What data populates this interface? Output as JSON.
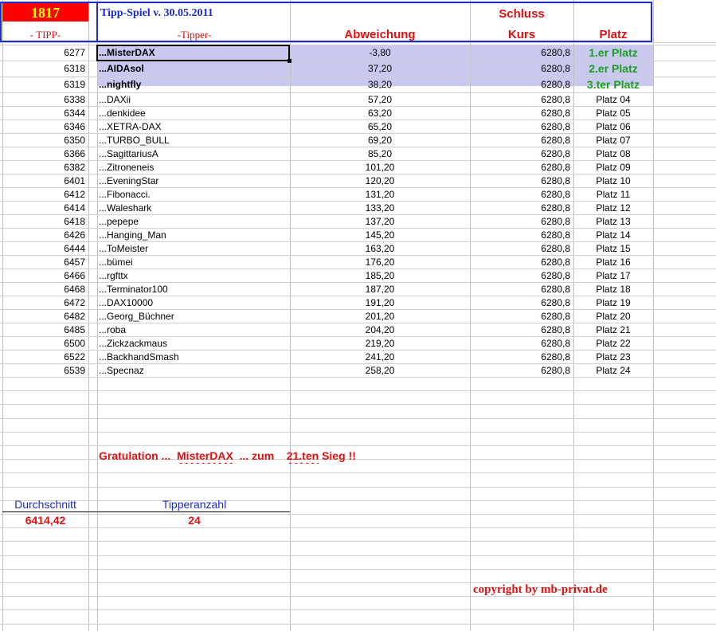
{
  "header": {
    "count": "1817",
    "title": "Tipp-Spiel v. 30.05.2011",
    "schluss": "Schluss",
    "col_tipp": "- TIPP-",
    "col_tipper": "-Tipper-",
    "col_abweichung": "Abweichung",
    "col_kurs": "Kurs",
    "col_platz": "Platz"
  },
  "colors": {
    "count_bg": "#ff0000",
    "count_fg": "#ffff00",
    "header_blue": "#1a2dcc",
    "header_red": "#e01010",
    "podium_bg": "#c8c8f0",
    "podium_green": "#1aa01a"
  },
  "rows": [
    {
      "tipp": "6277",
      "tipper": "...MisterDAX",
      "abw": "-3,80",
      "kurs": "6280,8",
      "platz": "1.er Platz"
    },
    {
      "tipp": "6318",
      "tipper": "...AIDAsol",
      "abw": "37,20",
      "kurs": "6280,8",
      "platz": "2.er Platz"
    },
    {
      "tipp": "6319",
      "tipper": "...nightfly",
      "abw": "38,20",
      "kurs": "6280,8",
      "platz": "3.ter Platz"
    },
    {
      "tipp": "6338",
      "tipper": "...DAXii",
      "abw": "57,20",
      "kurs": "6280,8",
      "platz": "Platz 04"
    },
    {
      "tipp": "6344",
      "tipper": "...denkidee",
      "abw": "63,20",
      "kurs": "6280,8",
      "platz": "Platz 05"
    },
    {
      "tipp": "6346",
      "tipper": "...XETRA-DAX",
      "abw": "65,20",
      "kurs": "6280,8",
      "platz": "Platz 06"
    },
    {
      "tipp": "6350",
      "tipper": "...TURBO_BULL",
      "abw": "69,20",
      "kurs": "6280,8",
      "platz": "Platz 07"
    },
    {
      "tipp": "6366",
      "tipper": "...SagittariusA",
      "abw": "85,20",
      "kurs": "6280,8",
      "platz": "Platz 08"
    },
    {
      "tipp": "6382",
      "tipper": "...Zitroneneis",
      "abw": "101,20",
      "kurs": "6280,8",
      "platz": "Platz 09"
    },
    {
      "tipp": "6401",
      "tipper": "...EveningStar",
      "abw": "120,20",
      "kurs": "6280,8",
      "platz": "Platz 10"
    },
    {
      "tipp": "6412",
      "tipper": "...Fibonacci.",
      "abw": "131,20",
      "kurs": "6280,8",
      "platz": "Platz 11"
    },
    {
      "tipp": "6414",
      "tipper": "...Waleshark",
      "abw": "133,20",
      "kurs": "6280,8",
      "platz": "Platz 12"
    },
    {
      "tipp": "6418",
      "tipper": "...pepepe",
      "abw": "137,20",
      "kurs": "6280,8",
      "platz": "Platz 13"
    },
    {
      "tipp": "6426",
      "tipper": "...Hanging_Man",
      "abw": "145,20",
      "kurs": "6280,8",
      "platz": "Platz 14"
    },
    {
      "tipp": "6444",
      "tipper": "...ToMeister",
      "abw": "163,20",
      "kurs": "6280,8",
      "platz": "Platz 15"
    },
    {
      "tipp": "6457",
      "tipper": "...bümei",
      "abw": "176,20",
      "kurs": "6280,8",
      "platz": "Platz 16"
    },
    {
      "tipp": "6466",
      "tipper": "...rgfttx",
      "abw": "185,20",
      "kurs": "6280,8",
      "platz": "Platz 17"
    },
    {
      "tipp": "6468",
      "tipper": "...Terminator100",
      "abw": "187,20",
      "kurs": "6280,8",
      "platz": "Platz 18"
    },
    {
      "tipp": "6472",
      "tipper": "...DAX10000",
      "abw": "191,20",
      "kurs": "6280,8",
      "platz": "Platz 19"
    },
    {
      "tipp": "6482",
      "tipper": "...Georg_Büchner",
      "abw": "201,20",
      "kurs": "6280,8",
      "platz": "Platz 20"
    },
    {
      "tipp": "6485",
      "tipper": "...roba",
      "abw": "204,20",
      "kurs": "6280,8",
      "platz": "Platz 21"
    },
    {
      "tipp": "6500",
      "tipper": "...Zickzackmaus",
      "abw": "219,20",
      "kurs": "6280,8",
      "platz": "Platz 22"
    },
    {
      "tipp": "6522",
      "tipper": "...BackhandSmash",
      "abw": "241,20",
      "kurs": "6280,8",
      "platz": "Platz 23"
    },
    {
      "tipp": "6539",
      "tipper": "...Specnaz",
      "abw": "258,20",
      "kurs": "6280,8",
      "platz": "Platz 24"
    }
  ],
  "gratulation": {
    "prefix": "Gratulation  ...",
    "winner": "MisterDAX",
    "middle": "...  zum",
    "sieg": "21.ten",
    "suffix": "Sieg !!"
  },
  "stats": {
    "avg_label": "Durchschnitt",
    "avg_value": "6414,42",
    "count_label": "Tipperanzahl",
    "count_value": "24"
  },
  "copyright": "copyright by mb-privat.de"
}
